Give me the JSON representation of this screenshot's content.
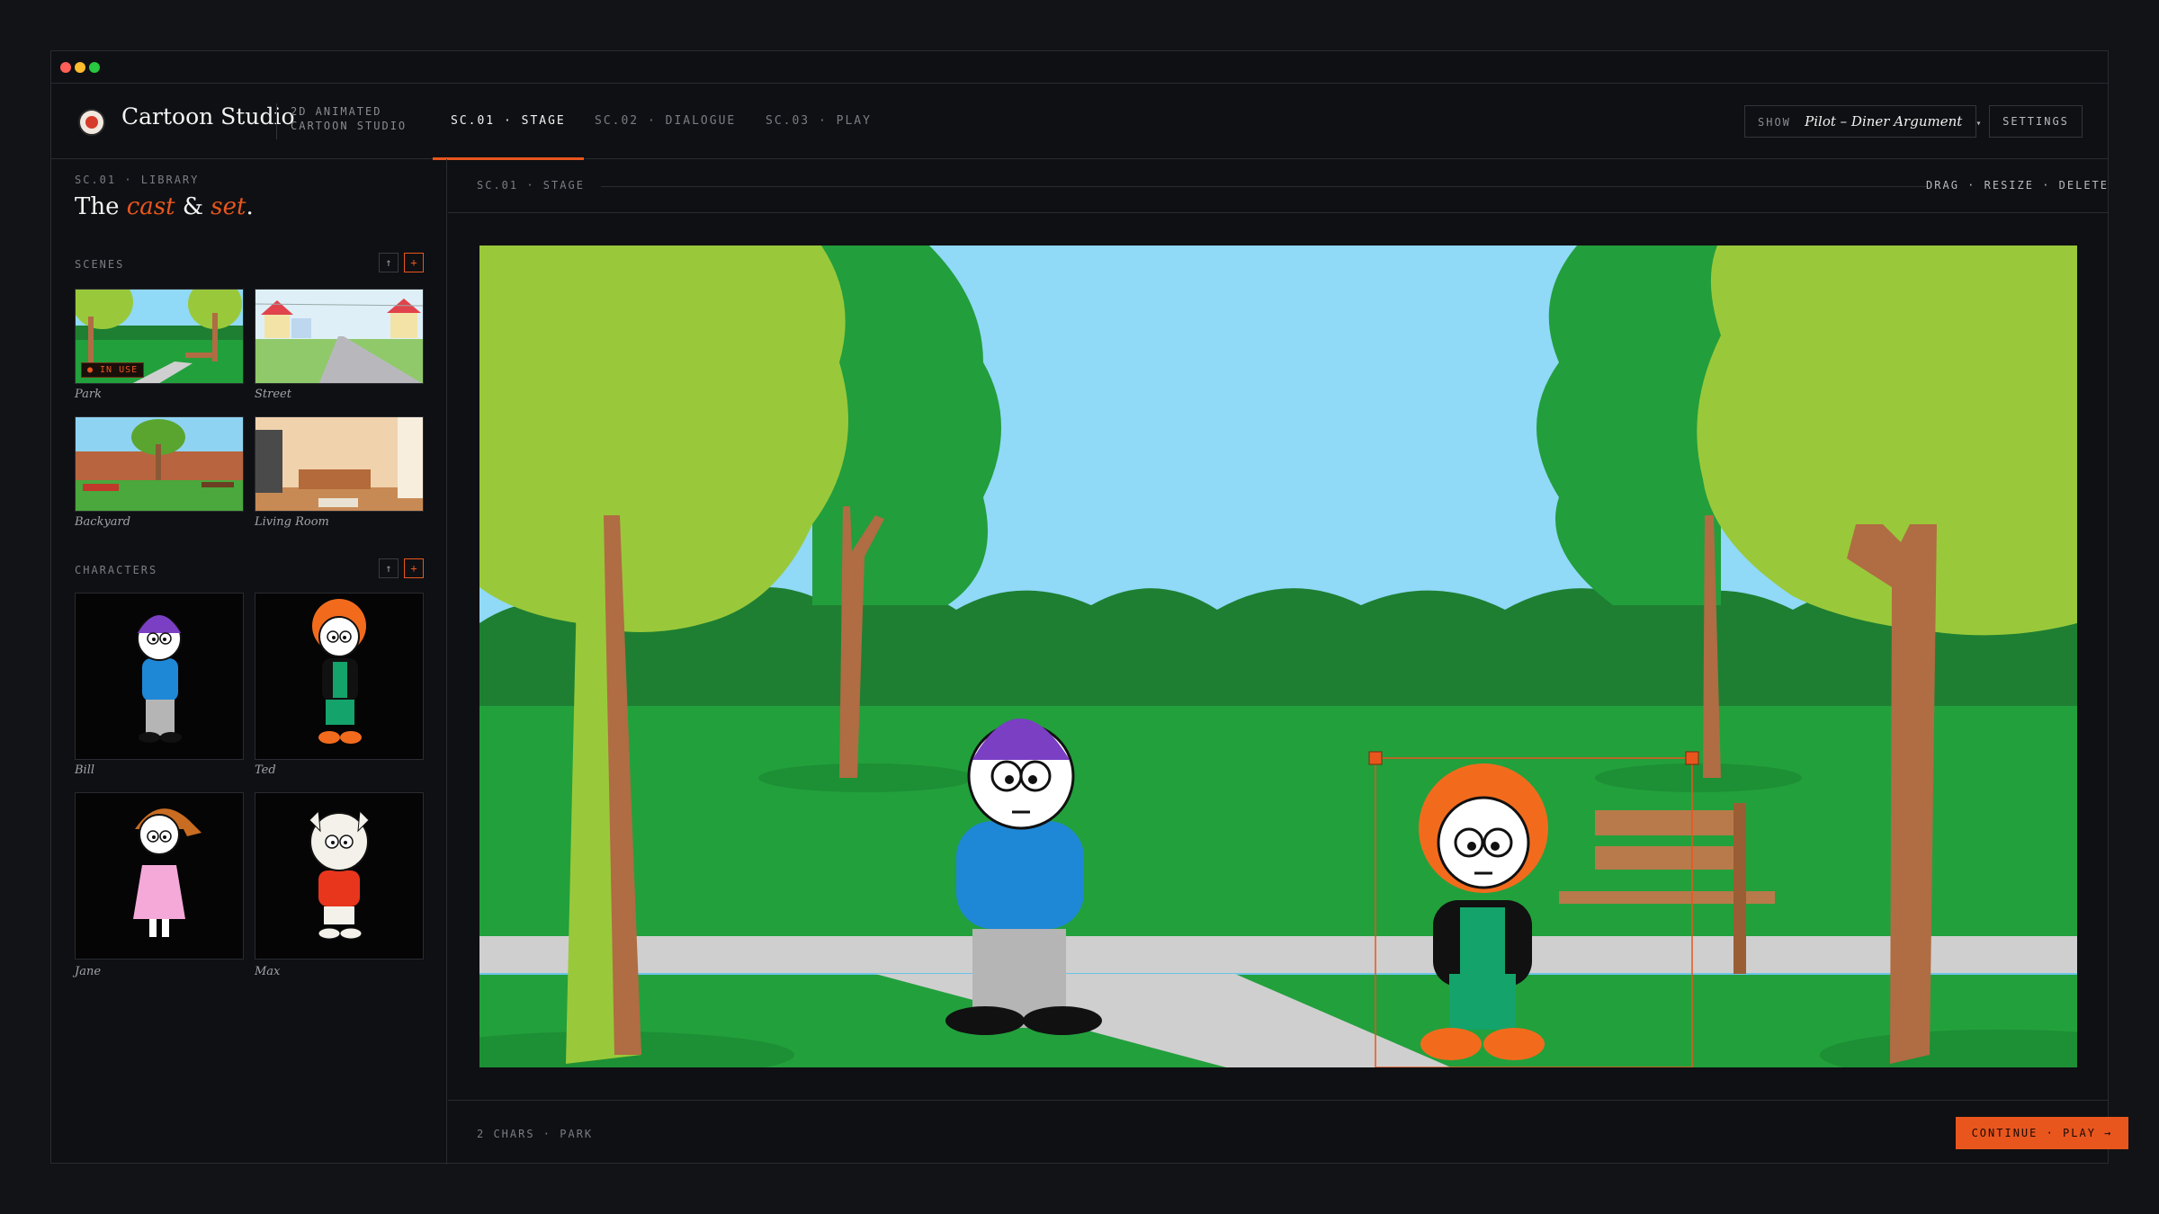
{
  "app": {
    "title": "Cartoon Studio",
    "subtitle": "2D ANIMATED CARTOON STUDIO"
  },
  "tabs": [
    {
      "label": "SC.01 · STAGE",
      "active": true
    },
    {
      "label": "SC.02 · DIALOGUE",
      "active": false
    },
    {
      "label": "SC.03 · PLAY",
      "active": false
    }
  ],
  "show": {
    "label": "SHOW",
    "name": "Pilot – Diner Argument",
    "caret": "▾"
  },
  "settings_label": "SETTINGS",
  "library": {
    "label": "SC.01 · LIBRARY",
    "heading": {
      "the": "The",
      "cast": "cast",
      "amp": "&",
      "set": "set",
      "dot": "."
    }
  },
  "scenes": {
    "label": "SCENES",
    "up_icon": "↑",
    "add_icon": "+",
    "items": [
      {
        "name": "Park",
        "badge": "● IN USE"
      },
      {
        "name": "Street"
      },
      {
        "name": "Backyard"
      },
      {
        "name": "Living Room"
      }
    ]
  },
  "characters": {
    "label": "CHARACTERS",
    "up_icon": "↑",
    "add_icon": "+",
    "items": [
      {
        "name": "Bill"
      },
      {
        "name": "Ted"
      },
      {
        "name": "Jane"
      },
      {
        "name": "Max"
      }
    ]
  },
  "stage": {
    "label": "SC.01 · STAGE",
    "actions": "DRAG · RESIZE · DELETE"
  },
  "footer": {
    "status": "2 CHARS · PARK",
    "continue_label": "CONTINUE · PLAY →"
  },
  "colors": {
    "accent": "#e8561e",
    "background": "#0f1013",
    "sky": "#90d9f7",
    "grass": "#22a03c",
    "tree_light": "#99c93a",
    "trunk": "#b06c43"
  }
}
